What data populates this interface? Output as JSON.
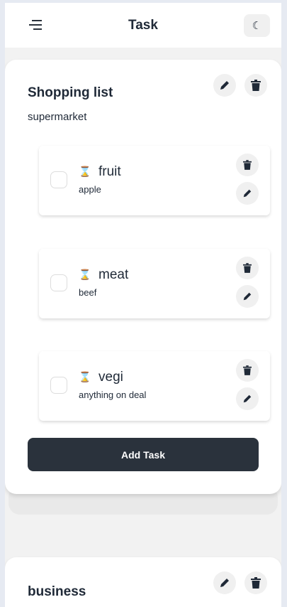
{
  "header": {
    "title": "Task",
    "menu_icon": "menu-icon",
    "theme_icon": "moon-icon"
  },
  "lists": [
    {
      "title": "Shopping list",
      "description": "supermarket",
      "add_label": "Add Task",
      "tasks": [
        {
          "name": "fruit",
          "description": "apple",
          "done": false
        },
        {
          "name": "meat",
          "description": "beef",
          "done": false
        },
        {
          "name": "vegi",
          "description": "anything on deal",
          "done": false
        }
      ]
    },
    {
      "title": "business"
    }
  ]
}
